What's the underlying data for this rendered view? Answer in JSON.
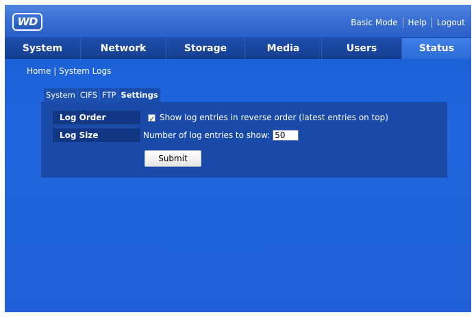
{
  "header": {
    "logo": "WD",
    "links": [
      "Basic Mode",
      "Help",
      "Logout"
    ]
  },
  "nav": {
    "tabs": [
      "System",
      "Network",
      "Storage",
      "Media",
      "Users",
      "Status"
    ],
    "active": "Status"
  },
  "breadcrumb": "Home | System Logs",
  "subtabs": {
    "items": [
      "System",
      "CIFS",
      "FTP",
      "Settings"
    ],
    "active": "Settings"
  },
  "settings": {
    "log_order_label": "Log Order",
    "log_order_checked": true,
    "log_order_text": "Show log entries in reverse order (latest entries on top)",
    "log_size_label": "Log Size",
    "log_size_text": "Number of log entries to show:",
    "log_size_value": "50",
    "submit_label": "Submit"
  },
  "colors": {
    "background": "#2166de",
    "nav": "#163f92",
    "active_tab": "#3f7fe6",
    "panel": "#1a4aa8",
    "label_cell": "#123784"
  }
}
